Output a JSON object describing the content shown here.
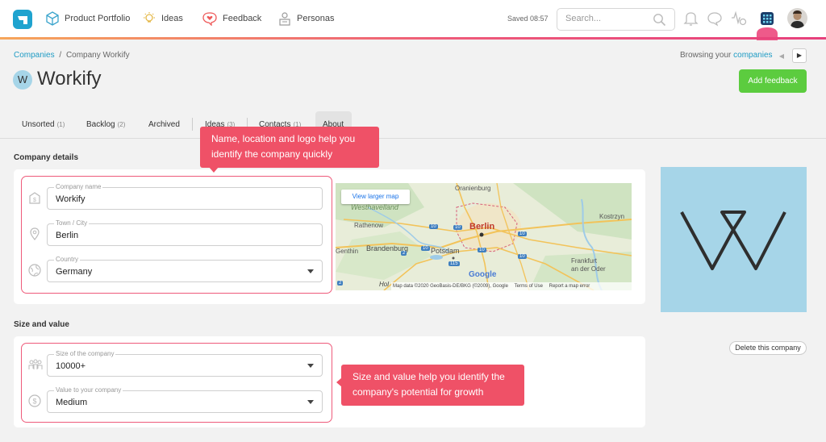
{
  "nav": {
    "items": [
      {
        "label": "Product Portfolio"
      },
      {
        "label": "Ideas"
      },
      {
        "label": "Feedback"
      },
      {
        "label": "Personas"
      }
    ],
    "saved_status": "Saved 08:57",
    "search_placeholder": "Search..."
  },
  "breadcrumb": {
    "root": "Companies",
    "separator": "/",
    "current": "Company Workify"
  },
  "browsing": {
    "prefix": "Browsing your",
    "link": "companies"
  },
  "company": {
    "initial": "W",
    "name": "Workify"
  },
  "add_feedback_label": "Add feedback",
  "tabs": [
    {
      "label": "Unsorted",
      "count": "(1)"
    },
    {
      "label": "Backlog",
      "count": "(2)"
    },
    {
      "label": "Archived",
      "count": ""
    },
    {
      "label": "Ideas",
      "count": "(3)"
    },
    {
      "label": "Contacts",
      "count": "(1)"
    },
    {
      "label": "About",
      "count": ""
    }
  ],
  "sections": {
    "details": "Company details",
    "size_value": "Size and value"
  },
  "details": {
    "company_name": {
      "label": "Company name",
      "value": "Workify"
    },
    "city": {
      "label": "Town / City",
      "value": "Berlin"
    },
    "country": {
      "label": "Country",
      "value": "Germany"
    }
  },
  "size_value": {
    "size": {
      "label": "Size of the company",
      "value": "10000+"
    },
    "value": {
      "label": "Value to your company",
      "value": "Medium"
    }
  },
  "map": {
    "view_larger": "View larger map",
    "places": {
      "oranienburg": "Oranienburg",
      "westhavelland": "Westhavelland",
      "rathenow": "Rathenow",
      "brandenburg": "Brandenburg",
      "genthin": "Genthin",
      "potsdam": "Potsdam",
      "berlin": "Berlin",
      "kostrzyn": "Kostrzyn",
      "frankfurt1": "Frankfurt",
      "frankfurt2": "an der Oder",
      "hol": "Hol"
    },
    "roads": [
      "10",
      "10",
      "10",
      "10",
      "115",
      "10",
      "10",
      "2",
      "2"
    ],
    "logo": "Google",
    "attribution": "Map data ©2020 GeoBasis-DE/BKG (©2009), Google",
    "terms": "Terms of Use",
    "report": "Report a map error"
  },
  "callouts": {
    "name_logo": "Name, location and logo help you identify the company quickly",
    "size_value": "Size and value help you identify the company's potential for growth"
  },
  "delete_label": "Delete this company",
  "colors": {
    "accent": "#1e9bc4",
    "green": "#5ccc3f",
    "callout": "#ef5167",
    "logo_bg": "#a6d5e8"
  }
}
